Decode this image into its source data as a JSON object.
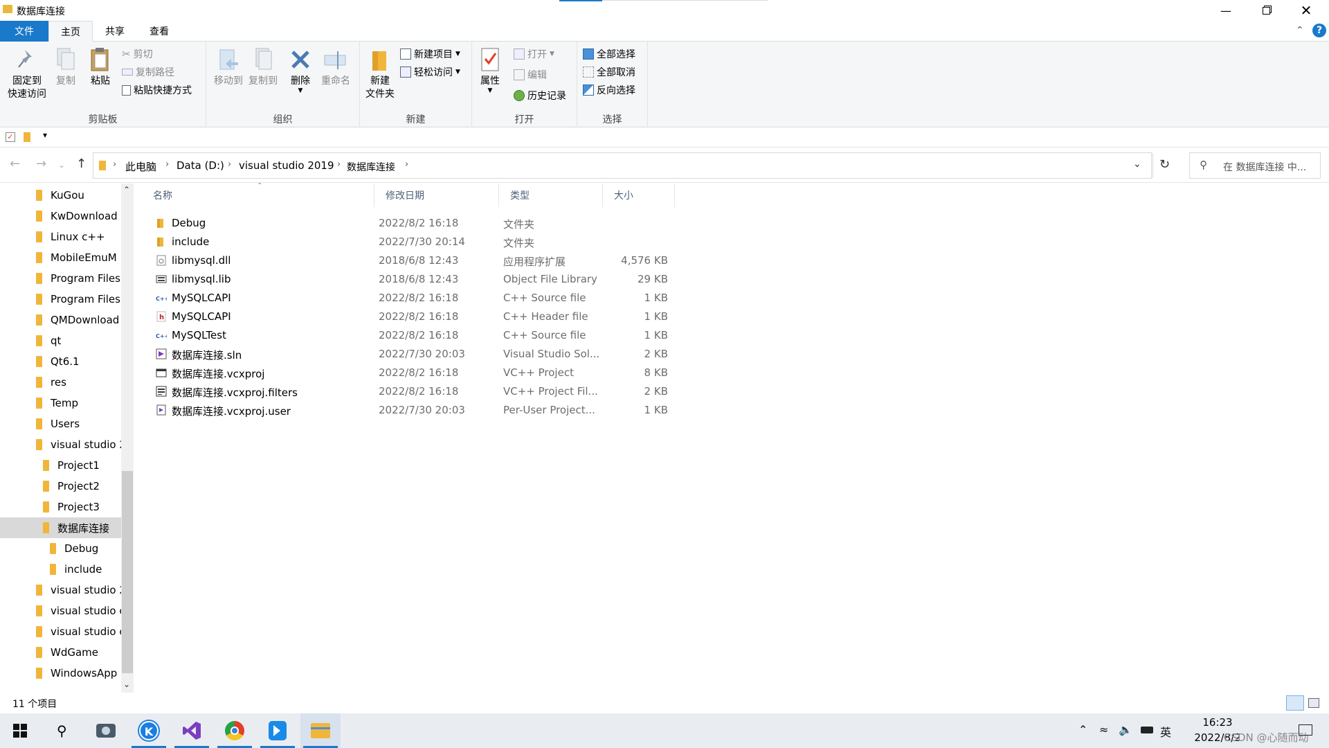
{
  "window": {
    "title": "数据库连接",
    "minimize_icon": "minimize-icon",
    "restore_icon": "restore-icon",
    "close_icon": "close-icon"
  },
  "tabs": [
    {
      "label": "文件"
    },
    {
      "label": "主页"
    },
    {
      "label": "共享"
    },
    {
      "label": "查看"
    }
  ],
  "ribbon": {
    "clipboard": {
      "label": "剪贴板",
      "pin": "固定到\n快速访问",
      "pin_line1": "固定到",
      "pin_line2": "快速访问",
      "copy": "复制",
      "paste": "粘贴",
      "cut": "剪切",
      "copy_path": "复制路径",
      "paste_shortcut": "粘贴快捷方式"
    },
    "organize": {
      "label": "组织",
      "move_to": "移动到",
      "copy_to": "复制到",
      "delete": "删除",
      "rename": "重命名"
    },
    "new": {
      "label": "新建",
      "new_folder_line1": "新建",
      "new_folder_line2": "文件夹",
      "new_item": "新建项目",
      "easy_access": "轻松访问"
    },
    "open": {
      "label": "打开",
      "properties": "属性",
      "open": "打开",
      "edit": "编辑",
      "history": "历史记录"
    },
    "select": {
      "label": "选择",
      "select_all": "全部选择",
      "select_none": "全部取消",
      "invert": "反向选择"
    }
  },
  "address": {
    "crumbs": [
      "此电脑",
      "Data (D:)",
      "visual studio 2019",
      "数据库连接"
    ],
    "search_placeholder": "在 数据库连接 中..."
  },
  "nav_tree": [
    {
      "label": "KuGou",
      "indent": 0
    },
    {
      "label": "KwDownload",
      "indent": 0
    },
    {
      "label": "Linux c++",
      "indent": 0
    },
    {
      "label": "MobileEmuM",
      "indent": 0
    },
    {
      "label": "Program Files",
      "indent": 0
    },
    {
      "label": "Program Files",
      "indent": 0
    },
    {
      "label": "QMDownload",
      "indent": 0
    },
    {
      "label": "qt",
      "indent": 0
    },
    {
      "label": "Qt6.1",
      "indent": 0
    },
    {
      "label": "res",
      "indent": 0
    },
    {
      "label": "Temp",
      "indent": 0
    },
    {
      "label": "Users",
      "indent": 0
    },
    {
      "label": "visual studio 2",
      "indent": 0
    },
    {
      "label": "Project1",
      "indent": 1
    },
    {
      "label": "Project2",
      "indent": 1
    },
    {
      "label": "Project3",
      "indent": 1
    },
    {
      "label": "数据库连接",
      "indent": 1,
      "selected": true
    },
    {
      "label": "Debug",
      "indent": 2
    },
    {
      "label": "include",
      "indent": 2
    },
    {
      "label": "visual studio 2",
      "indent": 0
    },
    {
      "label": "visual studio c",
      "indent": 0
    },
    {
      "label": "visual studio c",
      "indent": 0
    },
    {
      "label": "WdGame",
      "indent": 0
    },
    {
      "label": "WindowsApp",
      "indent": 0
    }
  ],
  "columns": {
    "name": "名称",
    "date": "修改日期",
    "type": "类型",
    "size": "大小"
  },
  "files": [
    {
      "name": "Debug",
      "date": "2022/8/2 16:18",
      "type": "文件夹",
      "size": "",
      "icon": "folder-icon"
    },
    {
      "name": "include",
      "date": "2022/7/30 20:14",
      "type": "文件夹",
      "size": "",
      "icon": "folder-icon"
    },
    {
      "name": "libmysql.dll",
      "date": "2018/6/8 12:43",
      "type": "应用程序扩展",
      "size": "4,576 KB",
      "icon": "dll-file-icon"
    },
    {
      "name": "libmysql.lib",
      "date": "2018/6/8 12:43",
      "type": "Object File Library",
      "size": "29 KB",
      "icon": "lib-file-icon"
    },
    {
      "name": "MySQLCAPI",
      "date": "2022/8/2 16:18",
      "type": "C++ Source file",
      "size": "1 KB",
      "icon": "cpp-file-icon"
    },
    {
      "name": "MySQLCAPI",
      "date": "2022/8/2 16:18",
      "type": "C++ Header file",
      "size": "1 KB",
      "icon": "header-file-icon"
    },
    {
      "name": "MySQLTest",
      "date": "2022/8/2 16:18",
      "type": "C++ Source file",
      "size": "1 KB",
      "icon": "cpp-file-icon"
    },
    {
      "name": "数据库连接.sln",
      "date": "2022/7/30 20:03",
      "type": "Visual Studio Sol...",
      "size": "2 KB",
      "icon": "sln-file-icon"
    },
    {
      "name": "数据库连接.vcxproj",
      "date": "2022/8/2 16:18",
      "type": "VC++ Project",
      "size": "8 KB",
      "icon": "vcxproj-file-icon"
    },
    {
      "name": "数据库连接.vcxproj.filters",
      "date": "2022/8/2 16:18",
      "type": "VC++ Project Fil...",
      "size": "2 KB",
      "icon": "filters-file-icon"
    },
    {
      "name": "数据库连接.vcxproj.user",
      "date": "2022/7/30 20:03",
      "type": "Per-User Project...",
      "size": "1 KB",
      "icon": "user-file-icon"
    }
  ],
  "status": {
    "count": "11 个项目"
  },
  "taskbar": {
    "clock_time": "16:23",
    "clock_date": "2022/8/2",
    "ime": "英",
    "watermark": "CSDN @心随而动"
  },
  "colors": {
    "accent": "#1979ca",
    "folder": "#f0b63a"
  }
}
